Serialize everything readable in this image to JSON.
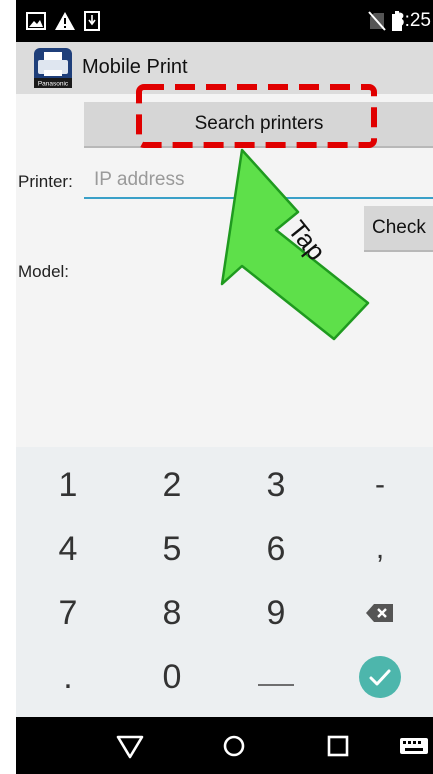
{
  "status_bar": {
    "time": "3:25",
    "icons": [
      "image-icon",
      "warning-icon",
      "download-icon",
      "no-sim-icon",
      "battery-icon"
    ]
  },
  "action_bar": {
    "app_icon": "panasonic-printer-icon",
    "app_icon_text": "Panasonic",
    "title": "Mobile Print"
  },
  "content": {
    "search_button_label": "Search printers",
    "printer_label": "Printer:",
    "ip_placeholder": "IP address",
    "ip_value": "",
    "check_button_label": "Check",
    "model_label": "Model:"
  },
  "keyboard": {
    "rows": [
      [
        "1",
        "2",
        "3",
        "-"
      ],
      [
        "4",
        "5",
        "6",
        ","
      ],
      [
        "7",
        "8",
        "9",
        "backspace-icon"
      ],
      [
        ".",
        "0",
        "space-icon",
        "done-check-icon"
      ]
    ],
    "accent_color": "#4db6ac"
  },
  "nav_bar": {
    "items": [
      "back-icon",
      "home-icon",
      "recents-icon",
      "keyboard-icon"
    ]
  },
  "annotation": {
    "arrow_text": "Tap",
    "highlight_color": "#e00000",
    "arrow_color": "#5ee04a"
  }
}
